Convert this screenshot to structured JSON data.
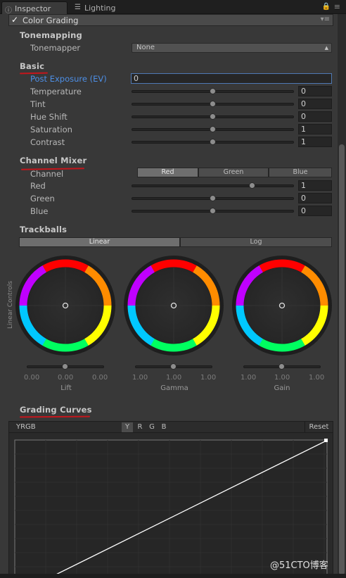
{
  "tabs": {
    "inspector": "Inspector",
    "lighting": "Lighting"
  },
  "component": {
    "title": "Color Grading",
    "enabled_mark": "✓"
  },
  "tonemapping": {
    "header": "Tonemapping",
    "label": "Tonemapper",
    "value": "None"
  },
  "basic": {
    "header": "Basic",
    "rows": [
      {
        "label": "Post Exposure (EV)",
        "value": "0"
      },
      {
        "label": "Temperature",
        "value": "0",
        "slider": 0.5
      },
      {
        "label": "Tint",
        "value": "0",
        "slider": 0.5
      },
      {
        "label": "Hue Shift",
        "value": "0",
        "slider": 0.5
      },
      {
        "label": "Saturation",
        "value": "1",
        "slider": 0.5
      },
      {
        "label": "Contrast",
        "value": "1",
        "slider": 0.5
      }
    ]
  },
  "channel_mixer": {
    "header": "Channel Mixer",
    "channel_label": "Channel",
    "channels": [
      "Red",
      "Green",
      "Blue"
    ],
    "selected": "Red",
    "rows": [
      {
        "label": "Red",
        "value": "1",
        "slider": 0.75
      },
      {
        "label": "Green",
        "value": "0",
        "slider": 0.5
      },
      {
        "label": "Blue",
        "value": "0",
        "slider": 0.5
      }
    ]
  },
  "trackballs": {
    "header": "Trackballs",
    "modes": [
      "Linear",
      "Log"
    ],
    "selected": "Linear",
    "side_label": "Linear Controls",
    "wheels": [
      {
        "name": "Lift",
        "values": [
          "0.00",
          "0.00",
          "0.00"
        ]
      },
      {
        "name": "Gamma",
        "values": [
          "1.00",
          "1.00",
          "1.00"
        ]
      },
      {
        "name": "Gain",
        "values": [
          "1.00",
          "1.00",
          "1.00"
        ]
      }
    ]
  },
  "grading_curves": {
    "header": "Grading Curves",
    "mode": "YRGB",
    "channels": [
      "Y",
      "R",
      "G",
      "B"
    ],
    "selected_channel": "Y",
    "reset": "Reset"
  },
  "watermark": "@51CTO博客",
  "colors": {
    "underline": "#c4161c",
    "focus_border": "#4f79b4",
    "label_blue": "#4d8fe6"
  }
}
